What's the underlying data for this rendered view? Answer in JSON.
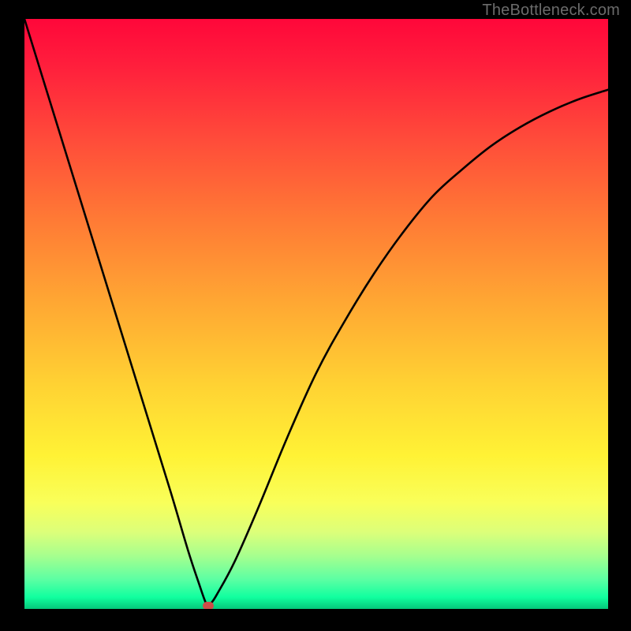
{
  "watermark": "TheBottleneck.com",
  "colors": {
    "curve": "#000000",
    "dot": "#cf4d48"
  },
  "chart_data": {
    "type": "line",
    "title": "",
    "xlabel": "",
    "ylabel": "",
    "xlim": [
      0,
      100
    ],
    "ylim": [
      0,
      100
    ],
    "grid": false,
    "legend": false,
    "annotations": [
      {
        "type": "dot",
        "x": 31.5,
        "y": 0.5
      }
    ],
    "series": [
      {
        "name": "curve",
        "x": [
          0,
          5,
          10,
          15,
          20,
          25,
          28,
          30,
          31,
          31.5,
          32,
          33,
          36,
          40,
          45,
          50,
          55,
          60,
          65,
          70,
          75,
          80,
          85,
          90,
          95,
          100
        ],
        "y": [
          100,
          84,
          68,
          52,
          36,
          20,
          10,
          4,
          1.2,
          0.5,
          1.0,
          2.5,
          8,
          17,
          29,
          40,
          49,
          57,
          64,
          70,
          74.5,
          78.5,
          81.7,
          84.3,
          86.4,
          88
        ]
      }
    ]
  }
}
